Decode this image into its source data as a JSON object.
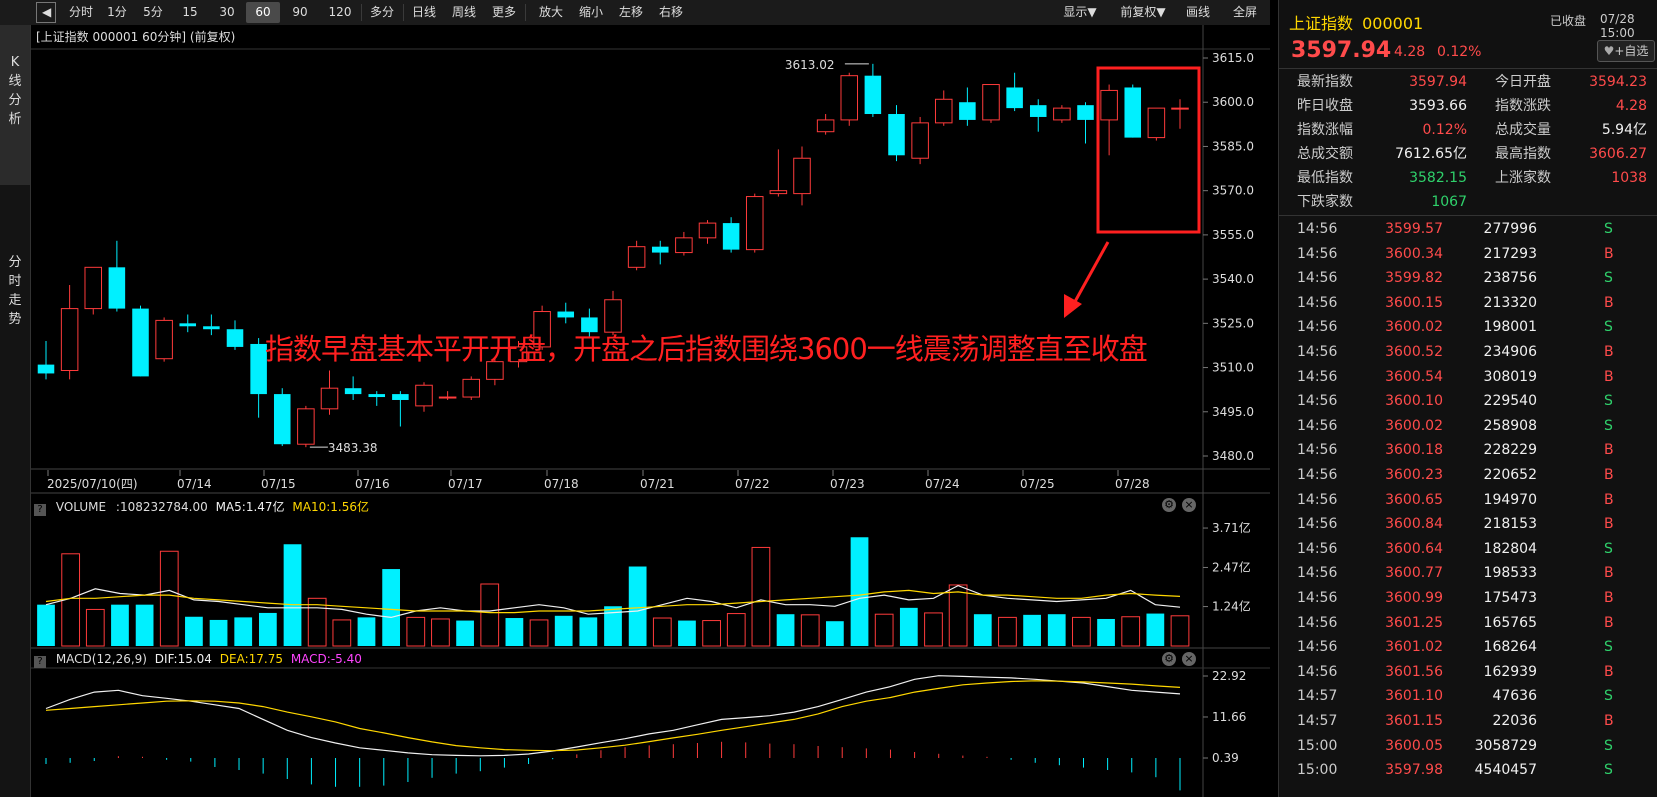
{
  "toolbar": {
    "back_icon": "back-arrow-icon",
    "periods": [
      "分时",
      "1分",
      "5分",
      "15分",
      "30分",
      "60分",
      "90分",
      "120分",
      "多分钟",
      "日线",
      "周线",
      "更多▼"
    ],
    "active_period": "60分",
    "actions": [
      "放大",
      "缩小",
      "左移",
      "右移"
    ],
    "right_actions": [
      "显示▼",
      "前复权▼",
      "画线",
      "全屏"
    ]
  },
  "side_tabs": [
    {
      "label": "K线分析",
      "chars": [
        "K",
        "线",
        "分",
        "析"
      ],
      "active": true
    },
    {
      "label": "分时走势",
      "chars": [
        "分",
        "时",
        "走",
        "势"
      ],
      "active": false
    }
  ],
  "kline": {
    "header": "[上证指数 000001 60分钟]  (前复权)",
    "y_ticks": [
      "3615.0",
      "3600.0",
      "3585.0",
      "3570.0",
      "3555.0",
      "3540.0",
      "3525.0",
      "3510.0",
      "3495.0",
      "3480.0"
    ],
    "dates": [
      "2025/07/10(四)",
      "07/14",
      "07/15",
      "07/16",
      "07/17",
      "07/18",
      "07/21",
      "07/22",
      "07/23",
      "07/24",
      "07/25",
      "07/28"
    ],
    "high_marker": "3613.02",
    "low_marker": "3483.38",
    "annotation": "指数早盘基本平开开盘，开盘之后指数围绕3600一线震荡调整直至收盘",
    "colors": {
      "up": "#ff3b3b",
      "down": "#00f0ff",
      "annotation": "#ff2020"
    }
  },
  "chart_data": [
    {
      "type": "candlestick",
      "title": "上证指数 000001 60分钟",
      "ylim": [
        3480,
        3615
      ],
      "candles": [
        {
          "o": 3511,
          "h": 3519,
          "l": 3506,
          "c": 3508
        },
        {
          "o": 3509,
          "h": 3538,
          "l": 3506,
          "c": 3530
        },
        {
          "o": 3530,
          "h": 3544,
          "l": 3528,
          "c": 3544
        },
        {
          "o": 3544,
          "h": 3553,
          "l": 3529,
          "c": 3530
        },
        {
          "o": 3530,
          "h": 3531,
          "l": 3507,
          "c": 3507
        },
        {
          "o": 3513,
          "h": 3527,
          "l": 3512,
          "c": 3526
        },
        {
          "o": 3525,
          "h": 3528,
          "l": 3522,
          "c": 3524
        },
        {
          "o": 3524,
          "h": 3528,
          "l": 3521,
          "c": 3523
        },
        {
          "o": 3523,
          "h": 3526,
          "l": 3516,
          "c": 3517
        },
        {
          "o": 3518,
          "h": 3520,
          "l": 3493,
          "c": 3501
        },
        {
          "o": 3501,
          "h": 3503,
          "l": 3483.38,
          "c": 3484
        },
        {
          "o": 3484,
          "h": 3497,
          "l": 3483,
          "c": 3496
        },
        {
          "o": 3496,
          "h": 3509,
          "l": 3494,
          "c": 3503
        },
        {
          "o": 3503,
          "h": 3507,
          "l": 3499,
          "c": 3501
        },
        {
          "o": 3501,
          "h": 3502,
          "l": 3497,
          "c": 3500
        },
        {
          "o": 3501,
          "h": 3502,
          "l": 3490,
          "c": 3499
        },
        {
          "o": 3497,
          "h": 3505,
          "l": 3495,
          "c": 3504
        },
        {
          "o": 3500,
          "h": 3502,
          "l": 3499,
          "c": 3500
        },
        {
          "o": 3500,
          "h": 3507,
          "l": 3499,
          "c": 3506
        },
        {
          "o": 3506,
          "h": 3513,
          "l": 3504,
          "c": 3512
        },
        {
          "o": 3512,
          "h": 3519,
          "l": 3510,
          "c": 3517
        },
        {
          "o": 3517,
          "h": 3531,
          "l": 3516,
          "c": 3529
        },
        {
          "o": 3529,
          "h": 3532,
          "l": 3525,
          "c": 3527
        },
        {
          "o": 3527,
          "h": 3530,
          "l": 3520,
          "c": 3522
        },
        {
          "o": 3522,
          "h": 3536,
          "l": 3521,
          "c": 3533
        },
        {
          "o": 3544,
          "h": 3553,
          "l": 3543,
          "c": 3551
        },
        {
          "o": 3551,
          "h": 3553,
          "l": 3545,
          "c": 3549
        },
        {
          "o": 3549,
          "h": 3556,
          "l": 3548,
          "c": 3554
        },
        {
          "o": 3554,
          "h": 3560,
          "l": 3552,
          "c": 3559
        },
        {
          "o": 3559,
          "h": 3561,
          "l": 3549,
          "c": 3550
        },
        {
          "o": 3550,
          "h": 3569,
          "l": 3549,
          "c": 3568
        },
        {
          "o": 3569,
          "h": 3584,
          "l": 3568,
          "c": 3570
        },
        {
          "o": 3569,
          "h": 3585,
          "l": 3565,
          "c": 3581
        },
        {
          "o": 3590,
          "h": 3596,
          "l": 3589,
          "c": 3594
        },
        {
          "o": 3594,
          "h": 3610,
          "l": 3592,
          "c": 3609
        },
        {
          "o": 3609,
          "h": 3613.02,
          "l": 3595,
          "c": 3596
        },
        {
          "o": 3596,
          "h": 3599,
          "l": 3580,
          "c": 3582
        },
        {
          "o": 3581,
          "h": 3595,
          "l": 3579,
          "c": 3593
        },
        {
          "o": 3593,
          "h": 3604,
          "l": 3592,
          "c": 3601
        },
        {
          "o": 3600,
          "h": 3605,
          "l": 3592,
          "c": 3594
        },
        {
          "o": 3594,
          "h": 3606,
          "l": 3593,
          "c": 3606
        },
        {
          "o": 3605,
          "h": 3610,
          "l": 3597,
          "c": 3598
        },
        {
          "o": 3599,
          "h": 3601,
          "l": 3590,
          "c": 3595
        },
        {
          "o": 3594,
          "h": 3599,
          "l": 3593,
          "c": 3598
        },
        {
          "o": 3599,
          "h": 3600,
          "l": 3586,
          "c": 3594
        },
        {
          "o": 3594,
          "h": 3606,
          "l": 3582,
          "c": 3604
        },
        {
          "o": 3605,
          "h": 3606,
          "l": 3588,
          "c": 3588
        },
        {
          "o": 3588,
          "h": 3598,
          "l": 3587,
          "c": 3598
        },
        {
          "o": 3598,
          "h": 3601,
          "l": 3591,
          "c": 3598
        }
      ]
    },
    {
      "type": "bar",
      "title": "VOLUME",
      "ylim": [
        0,
        3.9
      ],
      "values": [
        1.3,
        2.9,
        1.15,
        1.3,
        1.3,
        2.98,
        0.92,
        0.82,
        0.9,
        1.04,
        3.2,
        1.5,
        0.82,
        0.9,
        2.42,
        0.9,
        0.85,
        0.8,
        1.95,
        0.88,
        0.82,
        0.95,
        0.9,
        1.25,
        2.5,
        0.88,
        0.8,
        0.8,
        1.02,
        3.1,
        1.0,
        0.98,
        0.78,
        3.42,
        1.0,
        1.2,
        1.04,
        1.92,
        1.0,
        0.9,
        0.98,
        1.0,
        0.9,
        0.85,
        0.92,
        1.02,
        0.95
      ],
      "ma5": [
        1.3,
        1.5,
        1.8,
        1.65,
        1.6,
        1.75,
        1.45,
        1.4,
        1.3,
        1.2,
        1.2,
        1.2,
        1.15,
        1.0,
        0.9,
        1.1,
        1.2,
        1.1,
        1.1,
        1.2,
        1.3,
        1.2,
        1.0,
        1.05,
        1.1,
        1.3,
        1.5,
        1.4,
        1.2,
        1.45,
        1.3,
        1.3,
        1.25,
        1.5,
        1.6,
        1.45,
        1.5,
        1.9,
        1.6,
        1.5,
        1.45,
        1.4,
        1.45,
        1.5,
        1.75,
        1.3,
        1.22
      ],
      "ma10": [
        1.4,
        1.5,
        1.5,
        1.55,
        1.6,
        1.6,
        1.5,
        1.45,
        1.4,
        1.35,
        1.3,
        1.3,
        1.25,
        1.2,
        1.15,
        1.1,
        1.1,
        1.1,
        1.05,
        1.05,
        1.1,
        1.1,
        1.1,
        1.15,
        1.2,
        1.25,
        1.3,
        1.3,
        1.35,
        1.4,
        1.45,
        1.5,
        1.55,
        1.6,
        1.7,
        1.75,
        1.65,
        1.7,
        1.6,
        1.6,
        1.55,
        1.5,
        1.5,
        1.6,
        1.65,
        1.6,
        1.56
      ],
      "up_flags": [
        0,
        1,
        1,
        0,
        0,
        1,
        0,
        0,
        0,
        0,
        0,
        1,
        1,
        0,
        0,
        1,
        1,
        0,
        1,
        0,
        1,
        0,
        0,
        0,
        0,
        1,
        0,
        1,
        1,
        1,
        0,
        1,
        0,
        0,
        1,
        0,
        1,
        1,
        0,
        1,
        0,
        0,
        1,
        0,
        1,
        0,
        1
      ]
    },
    {
      "type": "line",
      "title": "MACD(12,26,9)",
      "ylim": [
        0.39,
        22.92
      ],
      "dif": [
        14,
        16.5,
        18.5,
        19,
        17.5,
        16.8,
        16,
        15,
        14,
        11,
        8,
        6,
        4.5,
        3.2,
        2.5,
        1.8,
        1.3,
        1.1,
        1.0,
        1.1,
        1.5,
        2.3,
        3.4,
        4.6,
        5.7,
        7.0,
        8.0,
        9.5,
        11,
        11.5,
        12,
        13,
        14.5,
        16.5,
        18.5,
        20,
        22,
        23,
        22.8,
        22.6,
        22.4,
        22,
        21.5,
        21,
        20,
        19,
        18.5,
        18
      ],
      "dea": [
        13.5,
        14,
        14.5,
        15,
        15.5,
        16,
        16.1,
        16,
        15.5,
        14.5,
        13,
        11.7,
        10.3,
        8.5,
        7.3,
        6,
        4.8,
        3.8,
        3.2,
        2.7,
        2.5,
        2.4,
        2.6,
        3.2,
        3.9,
        4.9,
        5.9,
        6.9,
        8,
        9,
        10,
        11,
        12.5,
        14.5,
        16,
        17,
        18.5,
        19.5,
        20.5,
        21,
        21.4,
        21.6,
        21.5,
        21.3,
        21,
        20.7,
        20.2,
        19.8
      ],
      "macd_bars": [
        -1,
        -0.8,
        -0.5,
        0.3,
        0.2,
        -0.3,
        -0.6,
        -1.5,
        -2,
        -2.6,
        -3.5,
        -4.4,
        -4.8,
        -4.8,
        -4.6,
        -4,
        -3.3,
        -2.6,
        -2.2,
        -1.6,
        -1,
        -0.2,
        0.6,
        1.3,
        1.8,
        2.1,
        2.3,
        2.5,
        2.7,
        2.6,
        2.4,
        2.3,
        2,
        1.8,
        1.6,
        1.4,
        1,
        0.7,
        0.4,
        0.2,
        -0.3,
        -0.8,
        -1.2,
        -1.6,
        -2,
        -2.4,
        -3.2,
        -5.4
      ]
    }
  ],
  "volume_panel": {
    "label": "VOLUME",
    "value": ":108232784.00",
    "ma5": "MA5:1.47亿",
    "ma10": "MA10:1.56亿",
    "y_ticks": [
      "3.71亿",
      "2.47亿",
      "1.24亿"
    ]
  },
  "macd_panel": {
    "label": "MACD(12,26,9)",
    "dif": "DIF:15.04",
    "dea": "DEA:17.75",
    "macd": "MACD:-5.40",
    "y_ticks": [
      "22.92",
      "11.66",
      "0.39"
    ]
  },
  "quote": {
    "name": "上证指数",
    "code": "000001",
    "status": "已收盘",
    "date_time": "07/28 15:00",
    "price": "3597.94",
    "change": "4.28",
    "change_pct": "0.12%",
    "watch_button": "+自选",
    "fields": [
      {
        "l1": "最新指数",
        "v1": "3597.94",
        "c1": "red",
        "l2": "今日开盘",
        "v2": "3594.23",
        "c2": "red"
      },
      {
        "l1": "昨日收盘",
        "v1": "3593.66",
        "c1": "white",
        "l2": "指数涨跌",
        "v2": "4.28",
        "c2": "red"
      },
      {
        "l1": "指数涨幅",
        "v1": "0.12%",
        "c1": "red",
        "l2": "总成交量",
        "v2": "5.94亿",
        "c2": "white"
      },
      {
        "l1": "总成交额",
        "v1": "7612.65亿",
        "c1": "white",
        "l2": "最高指数",
        "v2": "3606.27",
        "c2": "red"
      },
      {
        "l1": "最低指数",
        "v1": "3582.15",
        "c1": "green",
        "l2": "上涨家数",
        "v2": "1038",
        "c2": "red"
      },
      {
        "l1": "下跌家数",
        "v1": "1067",
        "c1": "green",
        "l2": "",
        "v2": "",
        "c2": "white"
      }
    ],
    "ticks": [
      {
        "t": "14:56",
        "p": "3599.57",
        "pc": "red",
        "v": "277996",
        "d": "S"
      },
      {
        "t": "14:56",
        "p": "3600.34",
        "pc": "red",
        "v": "217293",
        "d": "B"
      },
      {
        "t": "14:56",
        "p": "3599.82",
        "pc": "red",
        "v": "238756",
        "d": "S"
      },
      {
        "t": "14:56",
        "p": "3600.15",
        "pc": "red",
        "v": "213320",
        "d": "B"
      },
      {
        "t": "14:56",
        "p": "3600.02",
        "pc": "red",
        "v": "198001",
        "d": "S"
      },
      {
        "t": "14:56",
        "p": "3600.52",
        "pc": "red",
        "v": "234906",
        "d": "B"
      },
      {
        "t": "14:56",
        "p": "3600.54",
        "pc": "red",
        "v": "308019",
        "d": "B"
      },
      {
        "t": "14:56",
        "p": "3600.10",
        "pc": "red",
        "v": "229540",
        "d": "S"
      },
      {
        "t": "14:56",
        "p": "3600.02",
        "pc": "red",
        "v": "258908",
        "d": "S"
      },
      {
        "t": "14:56",
        "p": "3600.18",
        "pc": "red",
        "v": "228229",
        "d": "B"
      },
      {
        "t": "14:56",
        "p": "3600.23",
        "pc": "red",
        "v": "220652",
        "d": "B"
      },
      {
        "t": "14:56",
        "p": "3600.65",
        "pc": "red",
        "v": "194970",
        "d": "B"
      },
      {
        "t": "14:56",
        "p": "3600.84",
        "pc": "red",
        "v": "218153",
        "d": "B"
      },
      {
        "t": "14:56",
        "p": "3600.64",
        "pc": "red",
        "v": "182804",
        "d": "S"
      },
      {
        "t": "14:56",
        "p": "3600.77",
        "pc": "red",
        "v": "198533",
        "d": "B"
      },
      {
        "t": "14:56",
        "p": "3600.99",
        "pc": "red",
        "v": "175473",
        "d": "B"
      },
      {
        "t": "14:56",
        "p": "3601.25",
        "pc": "red",
        "v": "165765",
        "d": "B"
      },
      {
        "t": "14:56",
        "p": "3601.02",
        "pc": "red",
        "v": "168264",
        "d": "S"
      },
      {
        "t": "14:56",
        "p": "3601.56",
        "pc": "red",
        "v": "162939",
        "d": "B"
      },
      {
        "t": "14:57",
        "p": "3601.10",
        "pc": "red",
        "v": "47636",
        "d": "S"
      },
      {
        "t": "14:57",
        "p": "3601.15",
        "pc": "red",
        "v": "22036",
        "d": "B"
      },
      {
        "t": "15:00",
        "p": "3600.05",
        "pc": "red",
        "v": "3058729",
        "d": "S"
      },
      {
        "t": "15:00",
        "p": "3597.98",
        "pc": "red",
        "v": "4540457",
        "d": "S"
      }
    ]
  }
}
